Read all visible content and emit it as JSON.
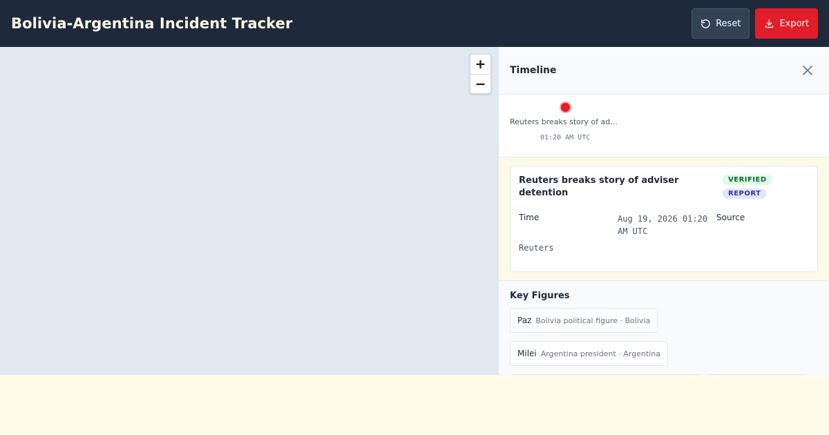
{
  "header": {
    "title": "Bolivia-Argentina Incident Tracker",
    "reset_label": "Reset",
    "export_label": "Export"
  },
  "map": {
    "zoom_in": "+",
    "zoom_out": "−"
  },
  "panel": {
    "title": "Timeline",
    "timeline": [
      {
        "label": "Reuters breaks story of ad...",
        "time": "01:20 AM UTC",
        "color": "#e11d2a"
      }
    ],
    "event": {
      "title": "Reuters breaks story of adviser detention",
      "badges": [
        "VERIFIED",
        "REPORT"
      ],
      "time_label": "Time",
      "time_value": "Aug 19, 2026 01:20 AM UTC",
      "source_label": "Source",
      "source_value": "Reuters"
    },
    "figures_title": "Key Figures",
    "figures": [
      {
        "name": "Paz",
        "role": "Bolivia political figure · Bolivia"
      },
      {
        "name": "Milei",
        "role": "Argentina president · Argentina"
      }
    ]
  },
  "colors": {
    "header_bg": "#1e293b",
    "accent": "#e11d2a",
    "verified": "#166534",
    "report": "#3730a3"
  }
}
